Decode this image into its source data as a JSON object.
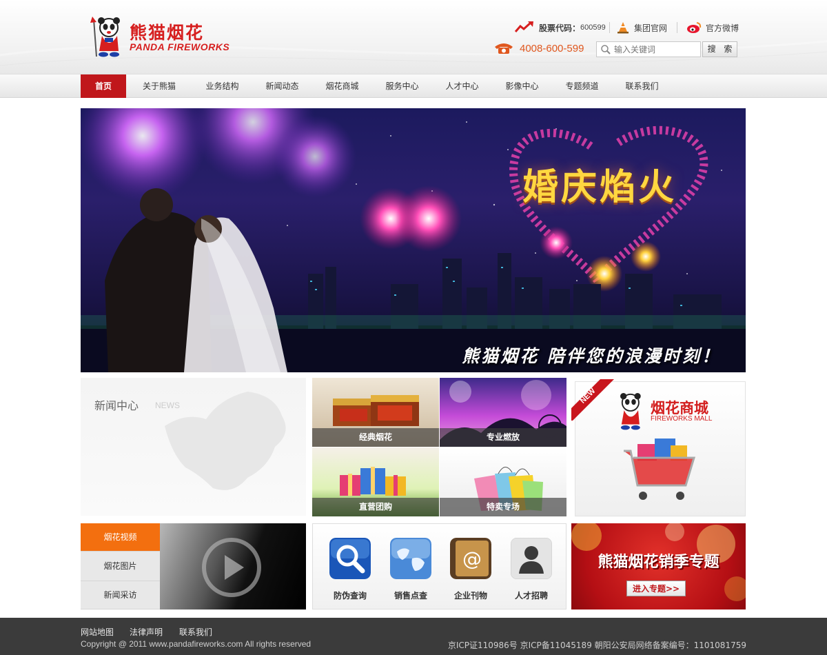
{
  "header": {
    "logo_cn": "熊猫烟花",
    "logo_en": "PANDA FIREWORKS",
    "stock_label": "股票代码：",
    "stock_code": "600599",
    "group_site": "集团官网",
    "weibo": "官方微博",
    "hotline": "4008-600-599",
    "search_placeholder": "输入关键词",
    "search_button": "搜 索"
  },
  "nav": {
    "items": [
      "首页",
      "关于熊猫",
      "业务结构",
      "新闻动态",
      "烟花商城",
      "服务中心",
      "人才中心",
      "影像中心",
      "专题频道",
      "联系我们"
    ],
    "active_index": 0
  },
  "banner": {
    "title": "婚庆焰火",
    "slogan": "熊猫烟花  陪伴您的浪漫时刻！"
  },
  "news": {
    "title": "新闻中心",
    "title_en": "NEWS"
  },
  "products": {
    "tiles": [
      "经典烟花",
      "专业燃放",
      "直营团购",
      "特卖专场"
    ]
  },
  "mall": {
    "badge": "NEW",
    "title": "烟花商城",
    "subtitle": "FIREWORKS MALL"
  },
  "media": {
    "tabs": [
      "烟花视频",
      "烟花图片",
      "新闻采访"
    ],
    "active_index": 0
  },
  "services": {
    "items": [
      {
        "label": "防伪查询",
        "icon": "search-icon"
      },
      {
        "label": "销售点查",
        "icon": "globe-icon"
      },
      {
        "label": "企业刊物",
        "icon": "at-book-icon"
      },
      {
        "label": "人才招聘",
        "icon": "person-icon"
      }
    ]
  },
  "promo": {
    "title": "熊猫烟花销季专题",
    "button": "进入专题>>"
  },
  "footer": {
    "links": [
      "网站地图",
      "法律声明",
      "联系我们"
    ],
    "copyright": "Copyright @ 2011 www.pandafireworks.com All rights reserved",
    "icp": "京ICP证110986号 京ICP备11045189  朝阳公安局网络备案编号：1101081759"
  },
  "colors": {
    "brand_red": "#c0171b",
    "accent_orange": "#f36f0f",
    "footer_bg": "#3b3b3b"
  }
}
